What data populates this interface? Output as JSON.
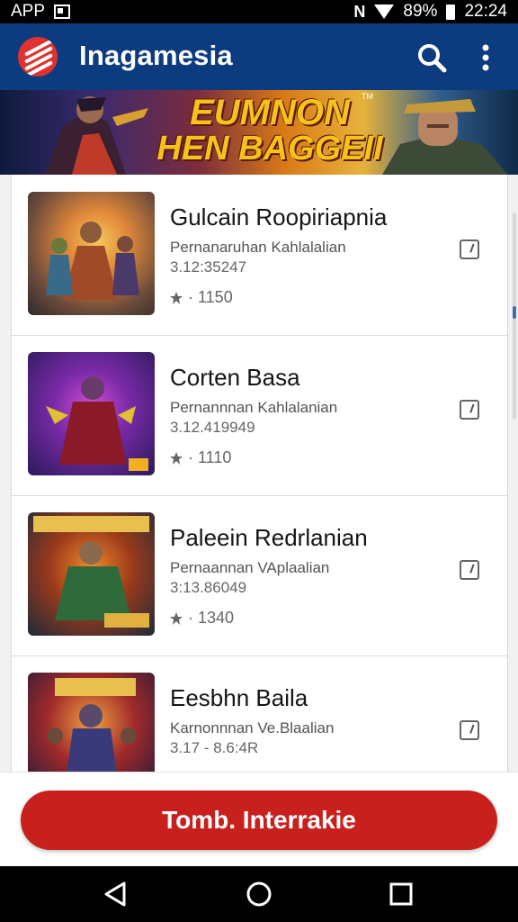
{
  "status_bar": {
    "left_label": "APP",
    "battery": "89%",
    "time": "22:24",
    "icons": [
      "image-notification-icon",
      "nfc-icon",
      "wifi-icon",
      "battery-icon"
    ]
  },
  "app_bar": {
    "title": "Inagamesia",
    "icons": [
      "app-logo-icon",
      "search-icon",
      "more-vertical-icon"
    ],
    "color": "#0d3b80"
  },
  "banner": {
    "line1": "EUMNON",
    "line2": "HEN BAGGEII",
    "tm": "TM"
  },
  "list": {
    "items": [
      {
        "title": "Gulcain Roopiriapnia",
        "subtitle": "Pernanaruhan Kahlalalian",
        "code": "3.12:35247",
        "stat": "· 1150",
        "thumb": "game-art-heroes"
      },
      {
        "title": "Corten Basa",
        "subtitle": "Pernannnan Kahlalanian",
        "code": "3.12.419949",
        "stat": "· 1110",
        "thumb": "game-art-warrior"
      },
      {
        "title": "Paleein Redrlanian",
        "subtitle": "Pernaannan VAplaalian",
        "code": "3:13.86049",
        "stat": "· 1340",
        "thumb": "game-art-brawler"
      },
      {
        "title": "Eesbhn Baila",
        "subtitle": "Karnonnnan Ve.Blaalian",
        "code": "3.17 - 8.6:4R",
        "stat": "",
        "thumb": "game-art-squad"
      }
    ]
  },
  "action_button": {
    "label": "Tomb. Interrakie",
    "color": "#c8201d"
  },
  "nav_bar": {
    "icons": [
      "back-icon",
      "home-icon",
      "recents-icon"
    ]
  }
}
